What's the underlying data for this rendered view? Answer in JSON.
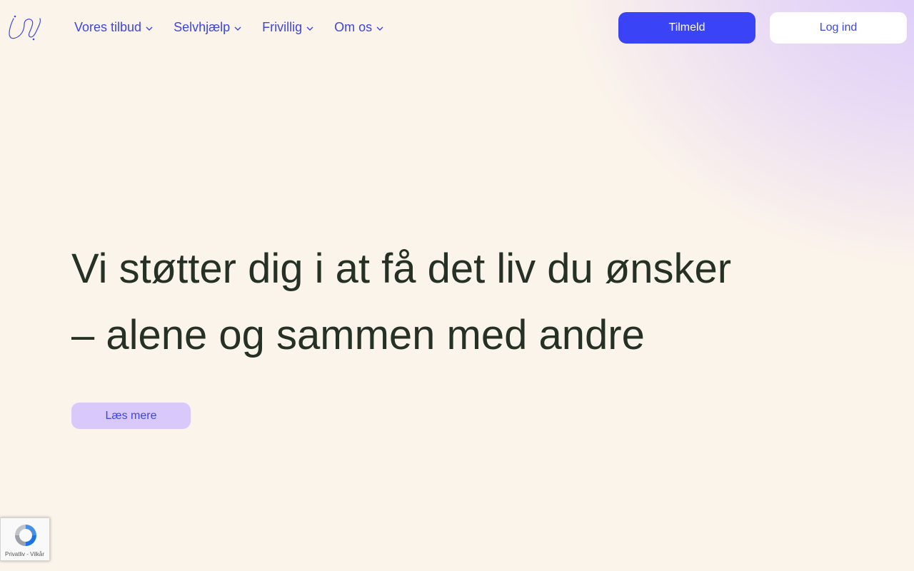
{
  "header": {
    "logo_icon": "scribble-logo-icon",
    "nav": [
      {
        "label": "Vores tilbud",
        "icon": "chevron-down-icon"
      },
      {
        "label": "Selvhjælp",
        "icon": "chevron-down-icon"
      },
      {
        "label": "Frivillig",
        "icon": "chevron-down-icon"
      },
      {
        "label": "Om os",
        "icon": "chevron-down-icon"
      }
    ],
    "signup_label": "Tilmeld",
    "login_label": "Log ind"
  },
  "hero": {
    "title_line1": "Vi støtter dig i at få det liv du ønsker",
    "title_line2": "– alene og sammen med andre",
    "cta_label": "Læs mere"
  },
  "recaptcha": {
    "icon": "recaptcha-icon",
    "privacy": "Privatliv",
    "separator": " - ",
    "terms": "Vilkår"
  },
  "colors": {
    "background": "#fbf4ea",
    "accent": "#3a43f5",
    "link": "#3f46e0",
    "lavender": "#d9c9fa",
    "text": "#263126"
  }
}
